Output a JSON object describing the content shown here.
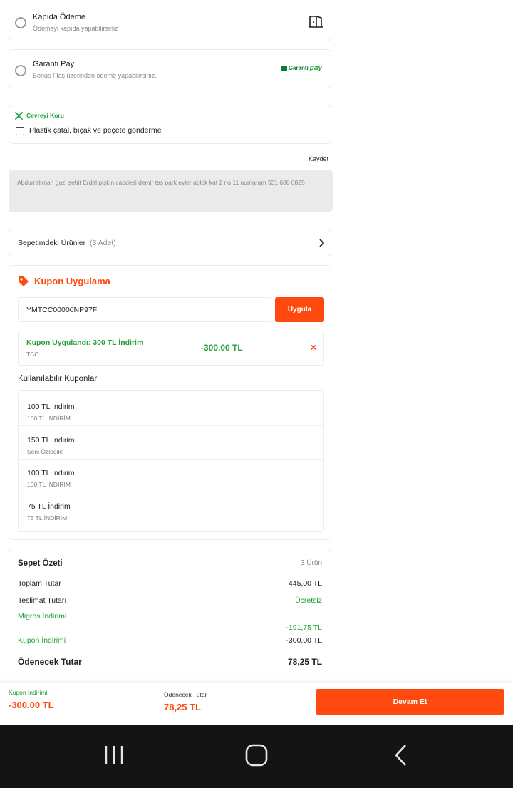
{
  "payment_methods": [
    {
      "title": "Kapıda Ödeme",
      "subtitle": "Ödemeyi kapıda yapabilirsiniz",
      "icon": "door-icon"
    },
    {
      "title": "Garanti Pay",
      "subtitle": "Bonus Flaş üzerinden ödeme yapabilirsiniz.",
      "logo_text_a": "Garanti",
      "logo_text_b": "pay"
    }
  ],
  "eco": {
    "title": "Çevreyi Koru",
    "checkbox_label": "Plastik çatal, bıçak ve peçete gönderme",
    "icon": "cutlery-icon"
  },
  "address": {
    "save_label": "Kaydet",
    "text": "Abdurrahman gazi şehit Erdal pişkin caddesi demir taş park evler ablok kat 2 no 11 numaram 531 688 0825"
  },
  "cart": {
    "label": "Sepetimdeki Ürünler",
    "count": "(3 Adet)"
  },
  "coupon": {
    "title": "Kupon Uygulama",
    "code": "YMTCC00000NP97F",
    "apply_label": "Uygula",
    "applied_title": "Kupon Uygulandı: 300 TL İndirim",
    "applied_sub": "TCC",
    "applied_amount": "-300.00 TL",
    "remove_label": "×",
    "available_title": "Kullanılabilir Kuponlar",
    "available": [
      {
        "title": "100 TL İndirim",
        "sub": "100 TL İNDİRİM"
      },
      {
        "title": "150 TL İndirim",
        "sub": "Seni Özledik!"
      },
      {
        "title": "100 TL İndirim",
        "sub": "100 TL İNDİRİM"
      },
      {
        "title": "75 TL İndirim",
        "sub": "75 TL İNDİRİM"
      }
    ]
  },
  "summary": {
    "title": "Sepet Özeti",
    "count": "3 Ürün",
    "total_label": "Toplam Tutar",
    "total_value": "445,00 TL",
    "delivery_label": "Teslimat Tutarı",
    "delivery_value": "Ücretsiz",
    "migros_label": "Migros İndirimi",
    "migros_value": "-191,75 TL",
    "coupon_label": "Kupon İndirimi",
    "coupon_value": "-300.00 TL",
    "payable_label": "Ödenecek Tutar",
    "payable_value": "78,25 TL"
  },
  "bottom": {
    "coupon_label": "Kupon İndirimi",
    "coupon_value": "-300.00 TL",
    "payable_label": "Ödenecek Tutar",
    "payable_value": "78,25 TL",
    "continue_label": "Devam Et"
  },
  "colors": {
    "accent": "#ff4a0f",
    "green": "#22a33a",
    "navbar": "#141414"
  }
}
